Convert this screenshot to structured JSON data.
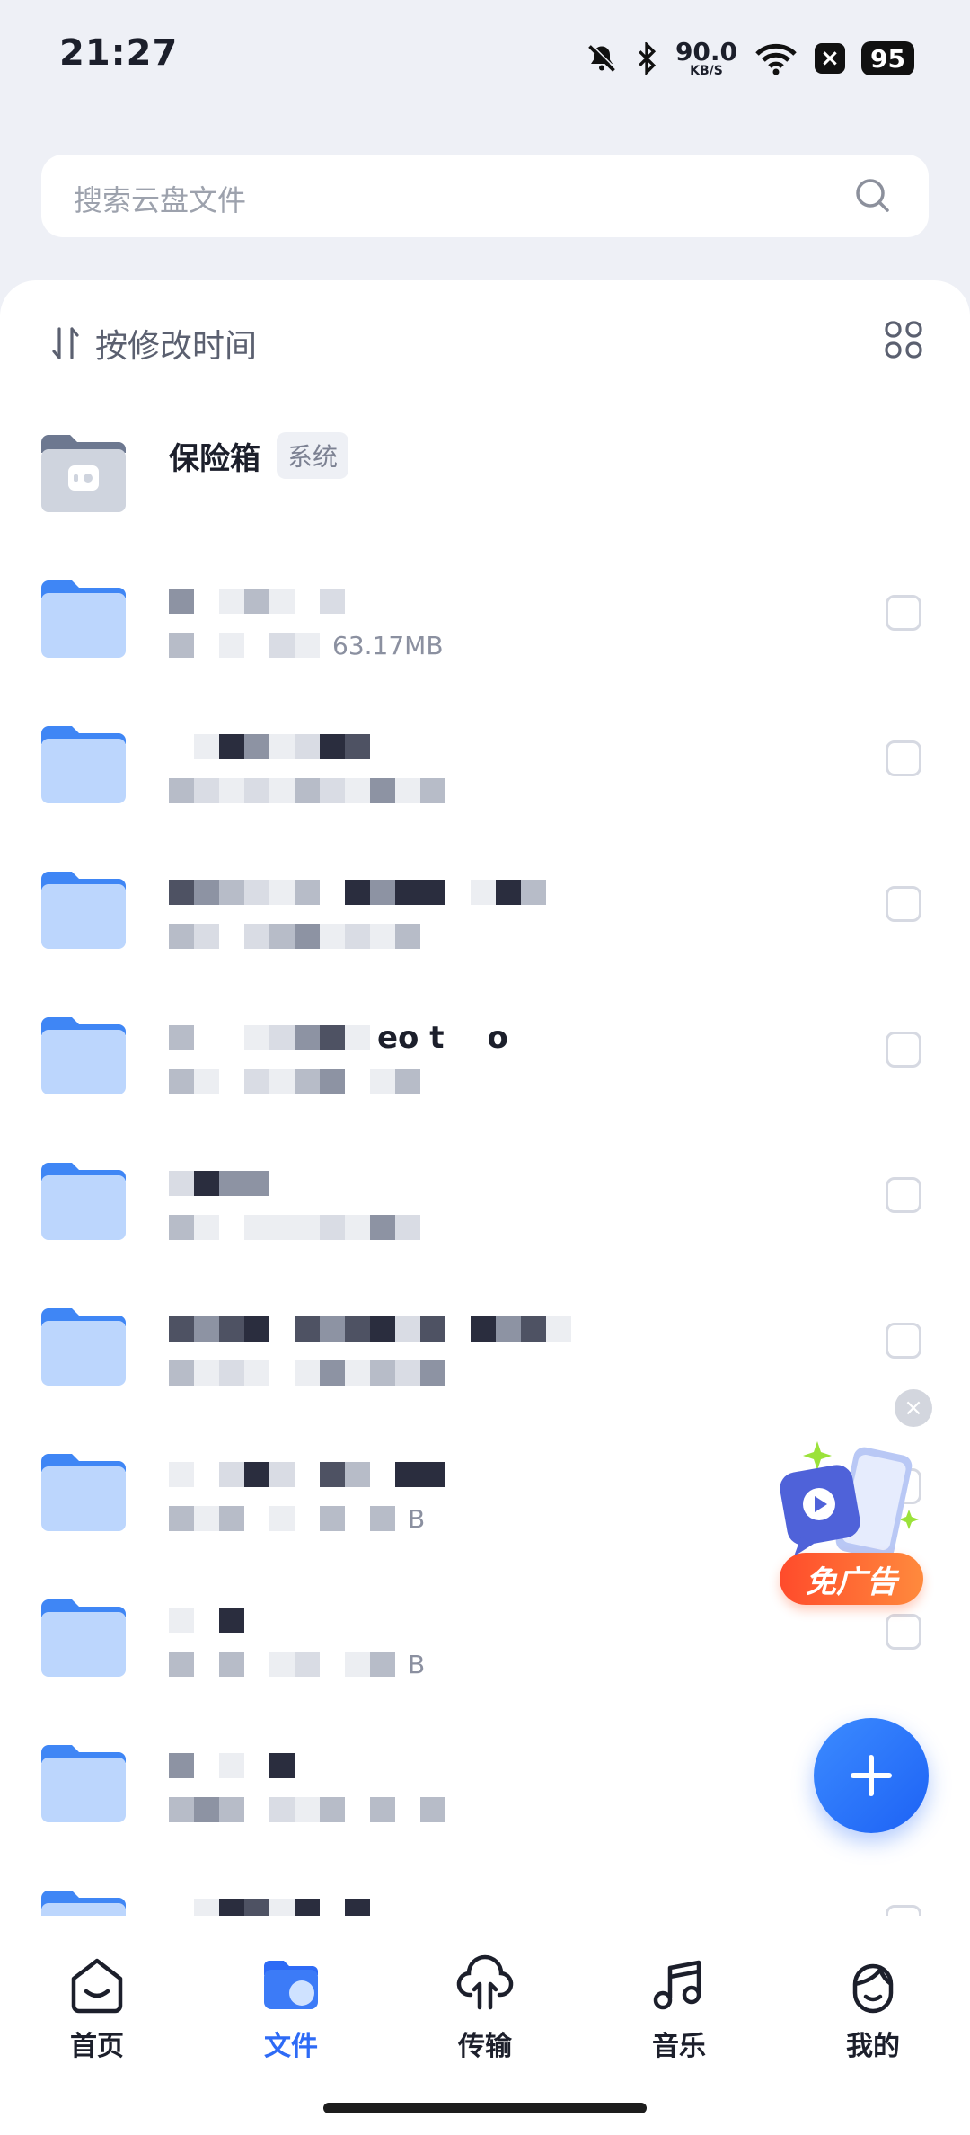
{
  "status": {
    "time": "21:27",
    "speed_value": "90.0",
    "speed_unit": "KB/S",
    "battery": "95",
    "x_badge": "×"
  },
  "search": {
    "placeholder": "搜索云盘文件"
  },
  "sort": {
    "label": "按修改时间"
  },
  "vault": {
    "name": "保险箱",
    "tag": "系统"
  },
  "files": [
    {
      "meta": "63.17MB"
    },
    {
      "meta": ""
    },
    {
      "meta": ""
    },
    {
      "title_fragment": "eo t",
      "title_fragment2": "o",
      "meta": ""
    },
    {
      "meta": ""
    },
    {
      "meta": ""
    },
    {
      "meta": "B"
    },
    {
      "meta": "B"
    },
    {
      "meta": ""
    },
    {
      "meta": ""
    }
  ],
  "ad": {
    "label": "免广告",
    "close": "×"
  },
  "tabs": [
    {
      "label": "首页",
      "icon": "home-icon"
    },
    {
      "label": "文件",
      "icon": "files-icon",
      "active": true
    },
    {
      "label": "传输",
      "icon": "transfer-icon"
    },
    {
      "label": "音乐",
      "icon": "music-icon"
    },
    {
      "label": "我的",
      "icon": "profile-icon"
    }
  ],
  "colors": {
    "accent": "#2e6bf6",
    "folder": "#6ea3f7",
    "ad": "#ff5a33"
  }
}
